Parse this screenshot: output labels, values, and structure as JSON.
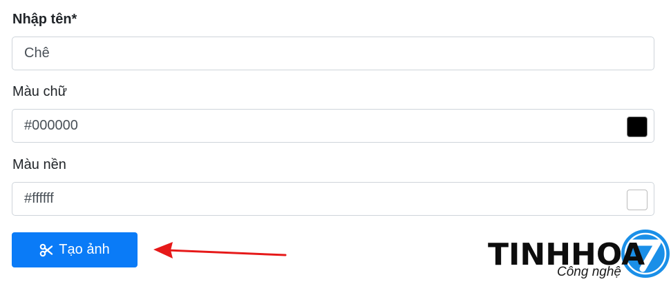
{
  "form": {
    "name": {
      "label": "Nhập tên*",
      "value": "Chê"
    },
    "text_color": {
      "label": "Màu chữ",
      "value": "#000000",
      "swatch_color": "#000000"
    },
    "bg_color": {
      "label": "Màu nền",
      "value": "#ffffff",
      "swatch_color": "#ffffff"
    },
    "submit": {
      "label": "Tạo ảnh",
      "icon": "scissors-icon",
      "color": "#0a7bf7"
    }
  },
  "annotation": {
    "arrow_color": "#e61919"
  },
  "watermark": {
    "brand": "TINHHOA",
    "tagline": "Công nghệ",
    "badge_color": "#1a8fe8"
  }
}
